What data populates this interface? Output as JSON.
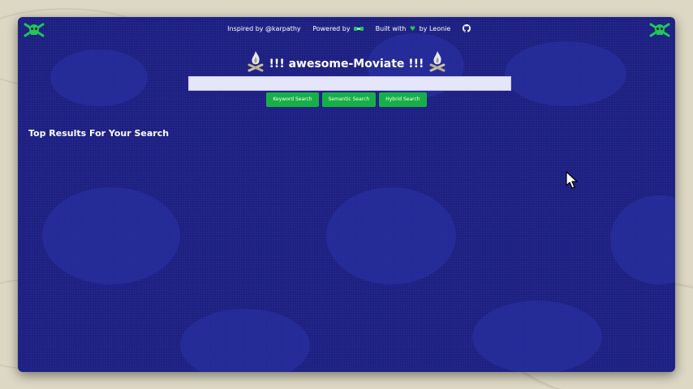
{
  "header": {
    "inspired_by": "Inspired by @karpathy",
    "powered_by": "Powered by",
    "built_with": "Built with",
    "by_author": "by Leonie"
  },
  "app": {
    "title": "!!! awesome-Moviate !!!"
  },
  "search": {
    "value": "",
    "placeholder": ""
  },
  "buttons": {
    "keyword": "Keyword Search",
    "semantic": "Semantic Search",
    "hybrid": "Hybrid Search"
  },
  "results": {
    "heading": "Top Results For Your Search"
  },
  "icons": {
    "left_logo": "skull-crossbones-icon",
    "right_logo": "skull-crossbones-icon",
    "powered_by_logo": "weaviate-logo-icon",
    "heart": "heart-icon",
    "github": "github-icon",
    "title_decoration": "campfire-icon"
  },
  "colors": {
    "background": "#1c1f82",
    "button": "#16b046",
    "accent_green": "#22c55e",
    "input": "#e6e6fa"
  }
}
